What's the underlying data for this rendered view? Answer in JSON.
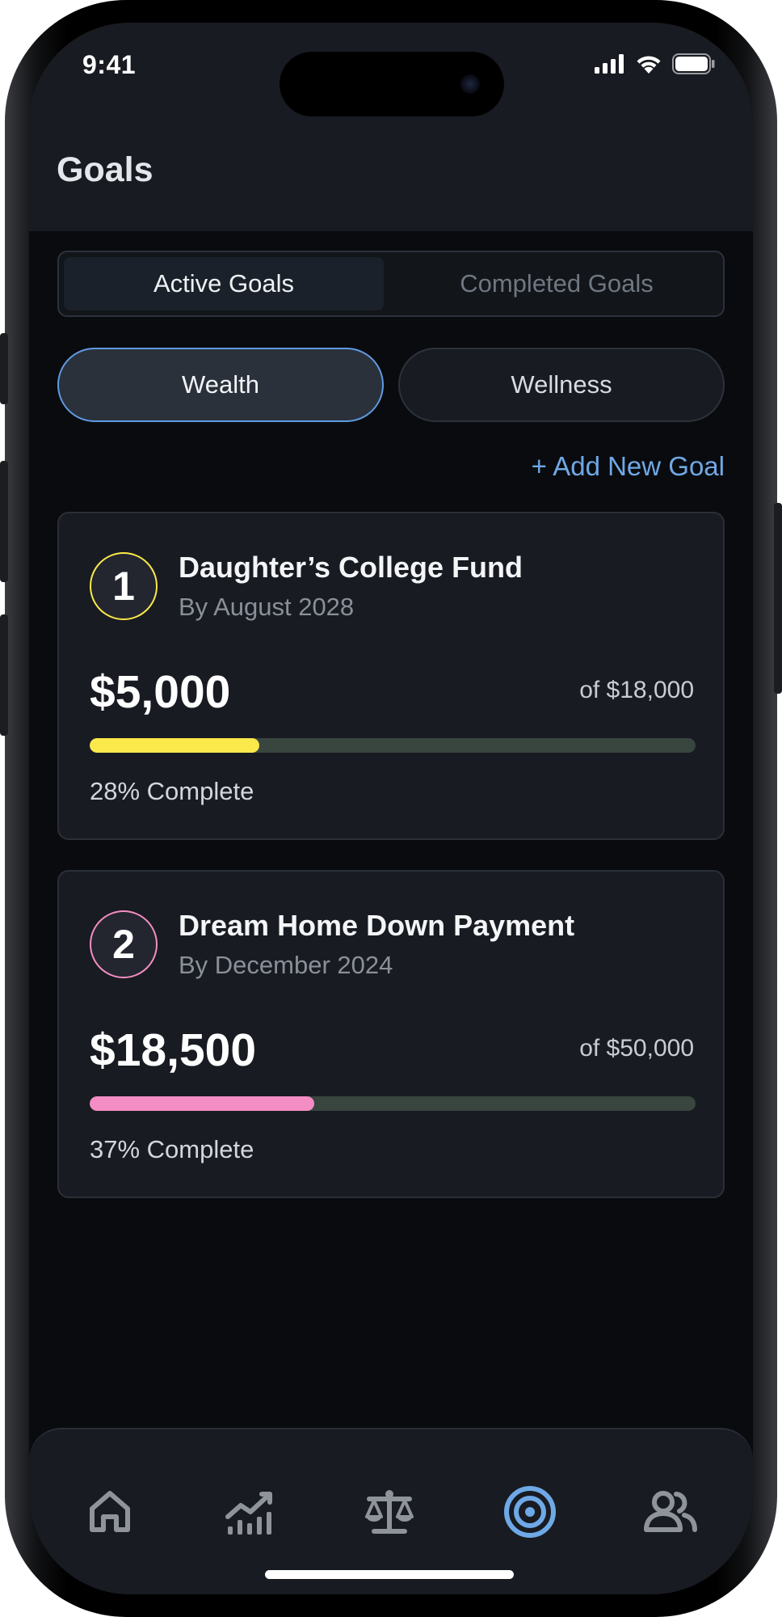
{
  "status_bar": {
    "time": "9:41"
  },
  "header": {
    "title": "Goals"
  },
  "segments": {
    "active": "Active Goals",
    "completed": "Completed Goals"
  },
  "categories": {
    "wealth": "Wealth",
    "wellness": "Wellness"
  },
  "add_goal_label": "+ Add New Goal",
  "goals": [
    {
      "number": "1",
      "title": "Daughter’s College Fund",
      "deadline": "By August 2028",
      "amount": "$5,000",
      "target": "of $18,000",
      "progress": 0.28,
      "progress_label": "28% Complete",
      "color": "#fbe94b"
    },
    {
      "number": "2",
      "title": "Dream Home Down Payment",
      "deadline": "By December 2024",
      "amount": "$18,500",
      "target": "of $50,000",
      "progress": 0.37,
      "progress_label": "37% Complete",
      "color": "#f48dc4"
    }
  ],
  "tabs": [
    {
      "icon": "home-icon",
      "active": false
    },
    {
      "icon": "chart-icon",
      "active": false
    },
    {
      "icon": "scale-icon",
      "active": false
    },
    {
      "icon": "target-icon",
      "active": true
    },
    {
      "icon": "people-icon",
      "active": false
    }
  ],
  "colors": {
    "accent": "#6fa8e6",
    "inactive_icon": "#8f949b",
    "track": "#39453f"
  }
}
